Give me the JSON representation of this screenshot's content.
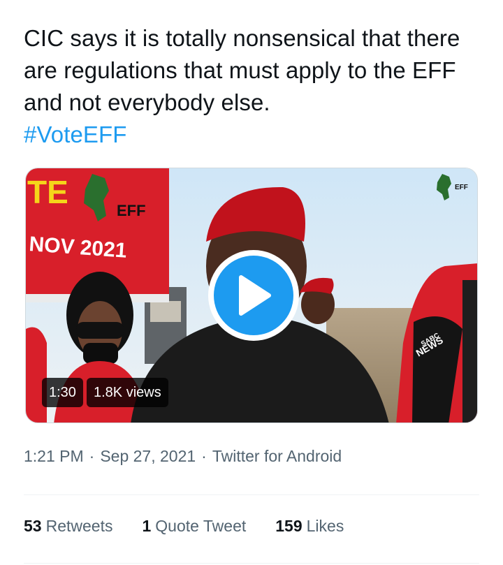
{
  "tweet": {
    "text": "CIC says it is totally nonsensical that there are regulations that must apply to the EFF and not everybody else.",
    "hashtag": "#VoteEFF"
  },
  "video": {
    "duration": "1:30",
    "views": "1.8K views",
    "banner_line1": "TE",
    "banner_logo": "EFF",
    "banner_line2": "NOV 2021",
    "watermark": "EFF",
    "mic_label_top": "SABC",
    "mic_label_bottom": "NEWS",
    "play_icon": "play-icon"
  },
  "meta": {
    "time": "1:21 PM",
    "date": "Sep 27, 2021",
    "source": "Twitter for Android"
  },
  "stats": [
    {
      "count": "53",
      "label": "Retweets"
    },
    {
      "count": "1",
      "label": "Quote Tweet"
    },
    {
      "count": "159",
      "label": "Likes"
    }
  ],
  "colors": {
    "accent": "#1d9bf0",
    "text": "#0f1419",
    "muted": "#536471",
    "eff_red": "#d81f2a"
  }
}
